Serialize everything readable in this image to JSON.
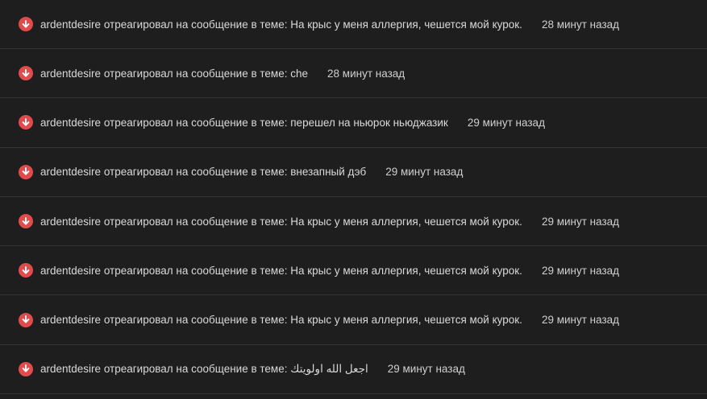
{
  "notifications": [
    {
      "user": "ardentdesire",
      "action": "отреагировал на сообщение в теме:",
      "thread": "На крыс у меня аллергия, чешется мой курок.",
      "time": "28 минут назад"
    },
    {
      "user": "ardentdesire",
      "action": "отреагировал на сообщение в теме:",
      "thread": "che",
      "time": "28 минут назад"
    },
    {
      "user": "ardentdesire",
      "action": "отреагировал на сообщение в теме:",
      "thread": "перешел на ньюрок ньюджазик",
      "time": "29 минут назад"
    },
    {
      "user": "ardentdesire",
      "action": "отреагировал на сообщение в теме:",
      "thread": "внезапный дэб",
      "time": "29 минут назад"
    },
    {
      "user": "ardentdesire",
      "action": "отреагировал на сообщение в теме:",
      "thread": "На крыс у меня аллергия, чешется мой курок.",
      "time": "29 минут назад"
    },
    {
      "user": "ardentdesire",
      "action": "отреагировал на сообщение в теме:",
      "thread": "На крыс у меня аллергия, чешется мой курок.",
      "time": "29 минут назад"
    },
    {
      "user": "ardentdesire",
      "action": "отреагировал на сообщение в теме:",
      "thread": "На крыс у меня аллергия, чешется мой курок.",
      "time": "29 минут назад"
    },
    {
      "user": "ardentdesire",
      "action": "отреагировал на сообщение в теме:",
      "thread": "اجعل الله اولويتك",
      "time": "29 минут назад"
    }
  ],
  "colors": {
    "background": "#1e1e1e",
    "divider": "#353535",
    "icon": "#e24b4b",
    "text": "#d9d9d9"
  },
  "icon_name": "down-arrow-circle-icon"
}
